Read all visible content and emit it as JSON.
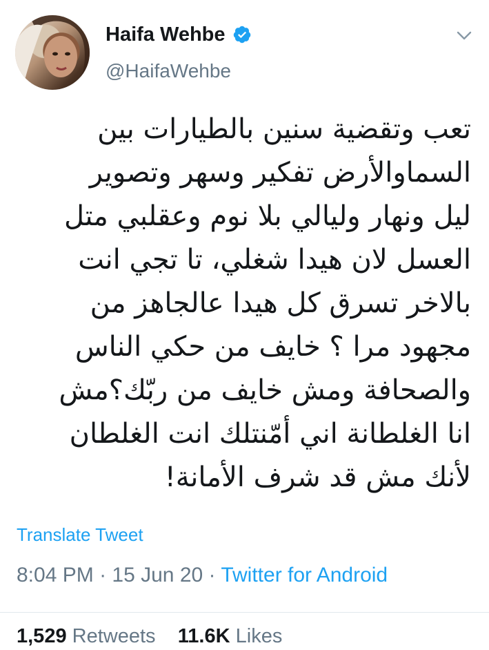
{
  "user": {
    "display_name": "Haifa Wehbe",
    "handle": "@HaifaWehbe",
    "verified_icon": "verified-badge-icon",
    "more_icon": "chevron-down-icon"
  },
  "tweet": {
    "lines": [
      "تعب وتقضية سنين بالطيارات بين",
      "السماوالأرض تفكير وسهر وتصوير",
      "ليل ونهار وليالي بلا نوم وعقلبي متل",
      "العسل لان هيدا شغلي، تا تجي انت",
      "بالاخر تسرق كل هيدا عالجاهز من",
      "مجهود مرا ؟ خايف من حكي الناس",
      "والصحافة ومش خايف من ربّك؟مش",
      "انا الغلطانة اني أمّنتلك انت الغلطان",
      "لأنك مش قد شرف الأمانة!"
    ],
    "translate_label": "Translate Tweet",
    "time": "8:04 PM",
    "separator": "·",
    "date": "15 Jun 20",
    "source": "Twitter for Android"
  },
  "stats": {
    "retweets_count": "1,529",
    "retweets_label": "Retweets",
    "likes_count": "11.6K",
    "likes_label": "Likes"
  },
  "colors": {
    "accent": "#1da1f2",
    "secondary_text": "#657786",
    "primary_text": "#14171a"
  }
}
